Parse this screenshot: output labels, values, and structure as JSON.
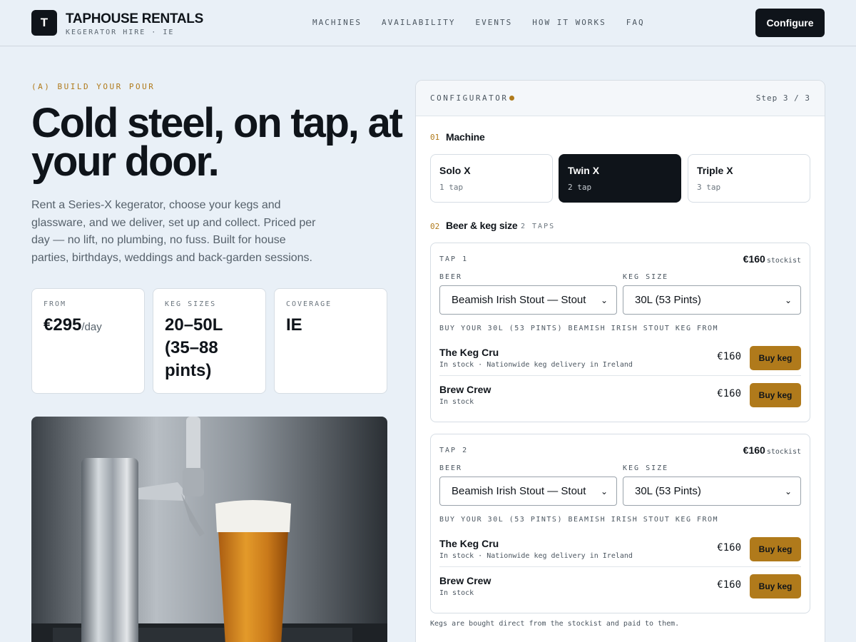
{
  "header": {
    "logo_letter": "T",
    "brand_name": "TAPHOUSE RENTALS",
    "brand_sub": "KEGERATOR HIRE · IE",
    "nav": [
      "MACHINES",
      "AVAILABILITY",
      "EVENTS",
      "HOW IT WORKS",
      "FAQ"
    ],
    "cta_label": "Configure"
  },
  "hero": {
    "eyebrow": "(A) BUILD YOUR POUR",
    "title": "Cold steel, on tap, at your door.",
    "description": "Rent a Series-X kegerator, choose your kegs and glassware, and we deliver, set up and collect. Priced per day — no lift, no plumbing, no fuss. Built for house parties, birthdays, weddings and back-garden sessions."
  },
  "stats": [
    {
      "label": "FROM",
      "value": "€295",
      "unit": "/day"
    },
    {
      "label": "KEG SIZES",
      "value": "20–50L (35–88 pints)",
      "unit": ""
    },
    {
      "label": "COVERAGE",
      "value": "IE",
      "unit": ""
    }
  ],
  "configurator": {
    "title": "CONFIGURATOR",
    "step": "Step 3 / 3",
    "machine_section": {
      "num": "01",
      "title": "Machine"
    },
    "machines": [
      {
        "name": "Solo X",
        "taps": "1 tap",
        "selected": false
      },
      {
        "name": "Twin X",
        "taps": "2 tap",
        "selected": true
      },
      {
        "name": "Triple X",
        "taps": "3 tap",
        "selected": false
      }
    ],
    "beer_section": {
      "num": "02",
      "title": "Beer & keg size",
      "note": "2 TAPS"
    },
    "taps": [
      {
        "label": "TAP 1",
        "price": "€160",
        "price_note": "stockist",
        "beer_label": "BEER",
        "beer_value": "Beamish Irish Stout — Stout",
        "keg_label": "KEG SIZE",
        "keg_value": "30L (53 Pints)",
        "buy_from": "BUY YOUR 30L (53 PINTS) BEAMISH IRISH STOUT KEG FROM",
        "vendors": [
          {
            "name": "The Keg Cru",
            "status": "In stock · Nationwide keg delivery in Ireland",
            "price": "€160",
            "button": "Buy keg"
          },
          {
            "name": "Brew Crew",
            "status": "In stock",
            "price": "€160",
            "button": "Buy keg"
          }
        ]
      },
      {
        "label": "TAP 2",
        "price": "€160",
        "price_note": "stockist",
        "beer_label": "BEER",
        "beer_value": "Beamish Irish Stout — Stout",
        "keg_label": "KEG SIZE",
        "keg_value": "30L (53 Pints)",
        "buy_from": "BUY YOUR 30L (53 PINTS) BEAMISH IRISH STOUT KEG FROM",
        "vendors": [
          {
            "name": "The Keg Cru",
            "status": "In stock · Nationwide keg delivery in Ireland",
            "price": "€160",
            "button": "Buy keg"
          },
          {
            "name": "Brew Crew",
            "status": "In stock",
            "price": "€160",
            "button": "Buy keg"
          }
        ]
      }
    ],
    "footnote": "Kegs are bought direct from the stockist and paid to them."
  },
  "colors": {
    "accent": "#b07a1b",
    "ink": "#0f141a",
    "background": "#e9f0f7"
  }
}
